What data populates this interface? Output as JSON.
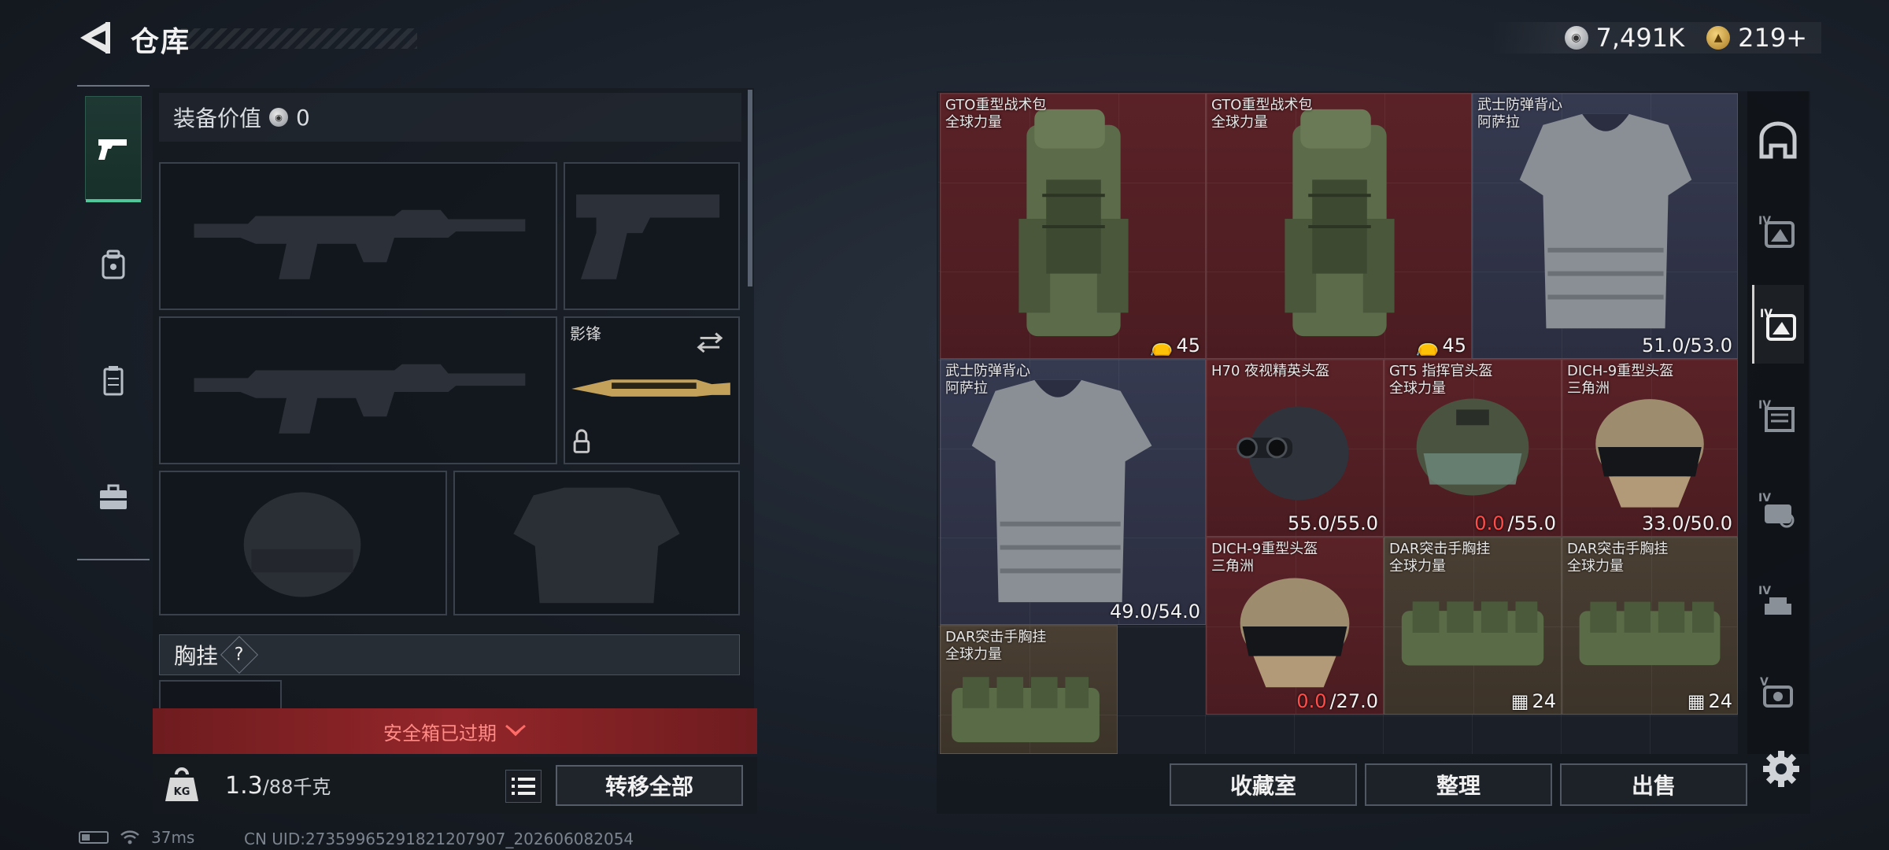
{
  "header": {
    "title": "仓库",
    "silver_amount": "7,491K",
    "gold_amount": "219+",
    "silver_icon": "silver-coin-icon",
    "gold_icon": "gold-coin-icon"
  },
  "categories": [
    {
      "name": "pistol-icon",
      "active": true
    },
    {
      "name": "backpack-icon",
      "active": false
    },
    {
      "name": "vest-icon",
      "active": false
    },
    {
      "name": "toolbox-icon",
      "active": false
    }
  ],
  "loadout": {
    "equip_value_label": "装备价值",
    "equip_value": "0",
    "melee_label": "影锋",
    "vest_section_label": "胸挂",
    "vest_help": "?",
    "expired_text": "安全箱已过期",
    "weight_current": "1.3",
    "weight_max": "/88千克",
    "transfer_all": "转移全部"
  },
  "inventory": {
    "items": [
      {
        "name_line1": "GTO重型战术包",
        "name_line2": "全球力量",
        "stat": "45",
        "stat_icon": "capacity-icon",
        "rarity": "red"
      },
      {
        "name_line1": "GTO重型战术包",
        "name_line2": "全球力量",
        "stat": "45",
        "stat_icon": "capacity-icon",
        "rarity": "red"
      },
      {
        "name_line1": "武士防弹背心",
        "name_line2": "阿萨拉",
        "stat": "51.0/53.0",
        "rarity": "purple"
      },
      {
        "name_line1": "武士防弹背心",
        "name_line2": "阿萨拉",
        "stat": "49.0/54.0",
        "rarity": "purple"
      },
      {
        "name_line1": "H70 夜视精英头盔",
        "name_line2": "",
        "stat": "55.0/55.0",
        "rarity": "red"
      },
      {
        "name_line1": "GT5 指挥官头盔",
        "name_line2": "全球力量",
        "stat_low": "0.0",
        "stat": "/55.0",
        "rarity": "red"
      },
      {
        "name_line1": "DICH-9重型头盔",
        "name_line2": "三角洲",
        "stat": "33.0/50.0",
        "rarity": "red"
      },
      {
        "name_line1": "DICH-9重型头盔",
        "name_line2": "三角洲",
        "stat_low": "0.0",
        "stat": "/27.0",
        "rarity": "red"
      },
      {
        "name_line1": "DAR突击手胸挂",
        "name_line2": "全球力量",
        "stat": "24",
        "stat_icon": "slots-icon",
        "rarity": "brown"
      },
      {
        "name_line1": "DAR突击手胸挂",
        "name_line2": "全球力量",
        "stat": "24",
        "stat_icon": "slots-icon",
        "rarity": "brown"
      },
      {
        "name_line1": "DAR突击手胸挂",
        "name_line2": "全球力量",
        "stat": "",
        "rarity": "brown"
      }
    ],
    "buttons": {
      "collection": "收藏室",
      "organize": "整理",
      "sell": "出售"
    }
  },
  "rail": [
    {
      "name": "storage-home-icon",
      "label": ""
    },
    {
      "name": "tier-4-bag-icon",
      "label": "IV"
    },
    {
      "name": "tier-4-armor-icon",
      "label": "IV",
      "active": true
    },
    {
      "name": "tier-4-chest-icon",
      "label": "IV"
    },
    {
      "name": "tier-4-gear-icon",
      "label": "IV"
    },
    {
      "name": "tier-4-misc-icon",
      "label": "IV"
    },
    {
      "name": "tier-5-icon",
      "label": "V"
    }
  ],
  "status": {
    "ping": "37ms",
    "uid": "CN UID:2735996529182120790​7_202606082054"
  }
}
